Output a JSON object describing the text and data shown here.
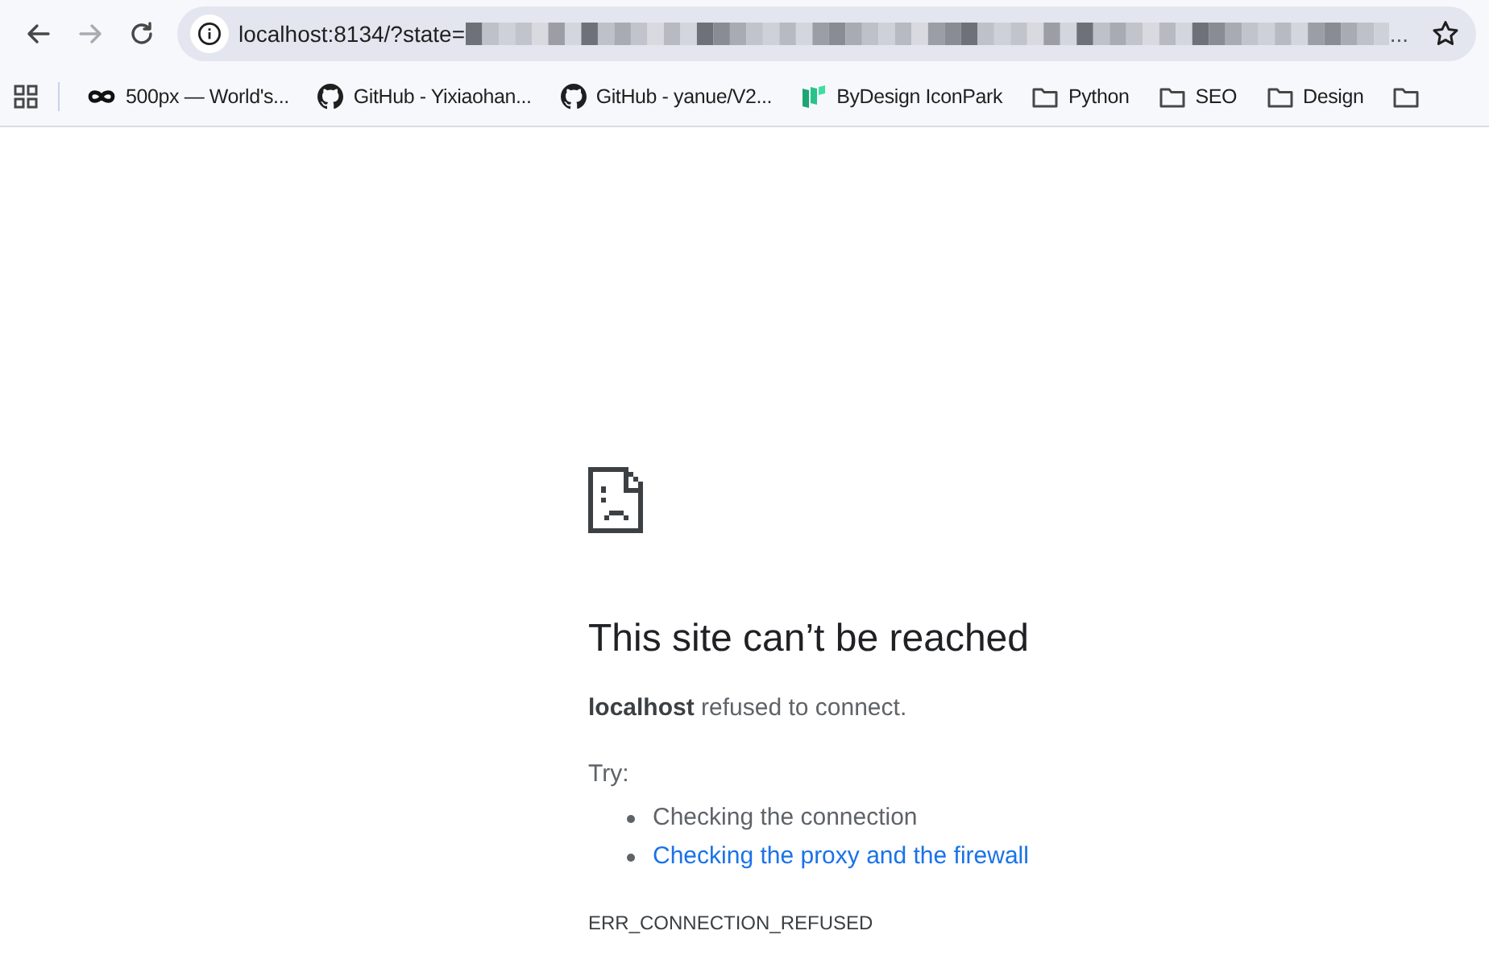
{
  "toolbar": {
    "back": {
      "disabled": false
    },
    "forward": {
      "disabled": true
    },
    "address": "localhost:8134/?state=",
    "address_ellipsis": "..."
  },
  "bookmarks": [
    {
      "kind": "infinity",
      "label": "500px — World's..."
    },
    {
      "kind": "github",
      "label": "GitHub - Yixiaohan..."
    },
    {
      "kind": "github",
      "label": "GitHub - yanue/V2..."
    },
    {
      "kind": "iconpark",
      "label": "ByDesign IconPark"
    },
    {
      "kind": "folder",
      "label": "Python"
    },
    {
      "kind": "folder",
      "label": "SEO"
    },
    {
      "kind": "folder",
      "label": "Design"
    },
    {
      "kind": "folder"
    }
  ],
  "error": {
    "title": "This site can’t be reached",
    "message": "**localhost** refused to connect.",
    "try_label": "Try:",
    "suggestions": [
      {
        "kind": "text",
        "text": "Checking the connection"
      },
      {
        "kind": "link",
        "text": "Checking the proxy and the firewall"
      }
    ],
    "code": "ERR_CONNECTION_REFUSED"
  }
}
